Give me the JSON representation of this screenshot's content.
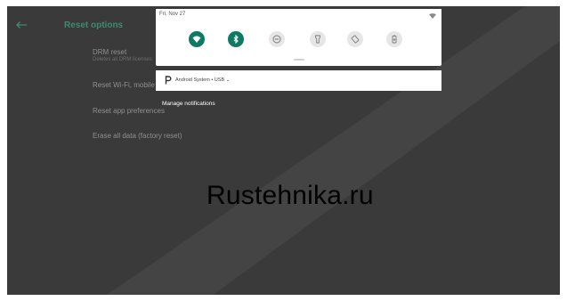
{
  "settings": {
    "title": "Reset options",
    "items": [
      {
        "label": "DRM reset",
        "sublabel": "Deletes all DRM licenses"
      },
      {
        "label": "Reset Wi-Fi, mobile & Bluetooth"
      },
      {
        "label": "Reset app preferences"
      },
      {
        "label": "Erase all data (factory reset)"
      }
    ]
  },
  "shade": {
    "date": "Fri, Nov 27",
    "tiles": [
      {
        "icon": "wifi-icon",
        "active": true
      },
      {
        "icon": "bluetooth-icon",
        "active": true
      },
      {
        "icon": "do-not-disturb-icon",
        "active": false
      },
      {
        "icon": "flashlight-icon",
        "active": false
      },
      {
        "icon": "auto-rotate-icon",
        "active": false
      },
      {
        "icon": "battery-saver-icon",
        "active": false
      }
    ]
  },
  "notification": {
    "text": "Android System • USB ⌄"
  },
  "manage_label": "Manage notifications",
  "watermark": "Rustehnika.ru",
  "colors": {
    "accent": "#0f7a64",
    "screen_dim": "#3a3a3a",
    "title_green": "#3d8a72"
  }
}
